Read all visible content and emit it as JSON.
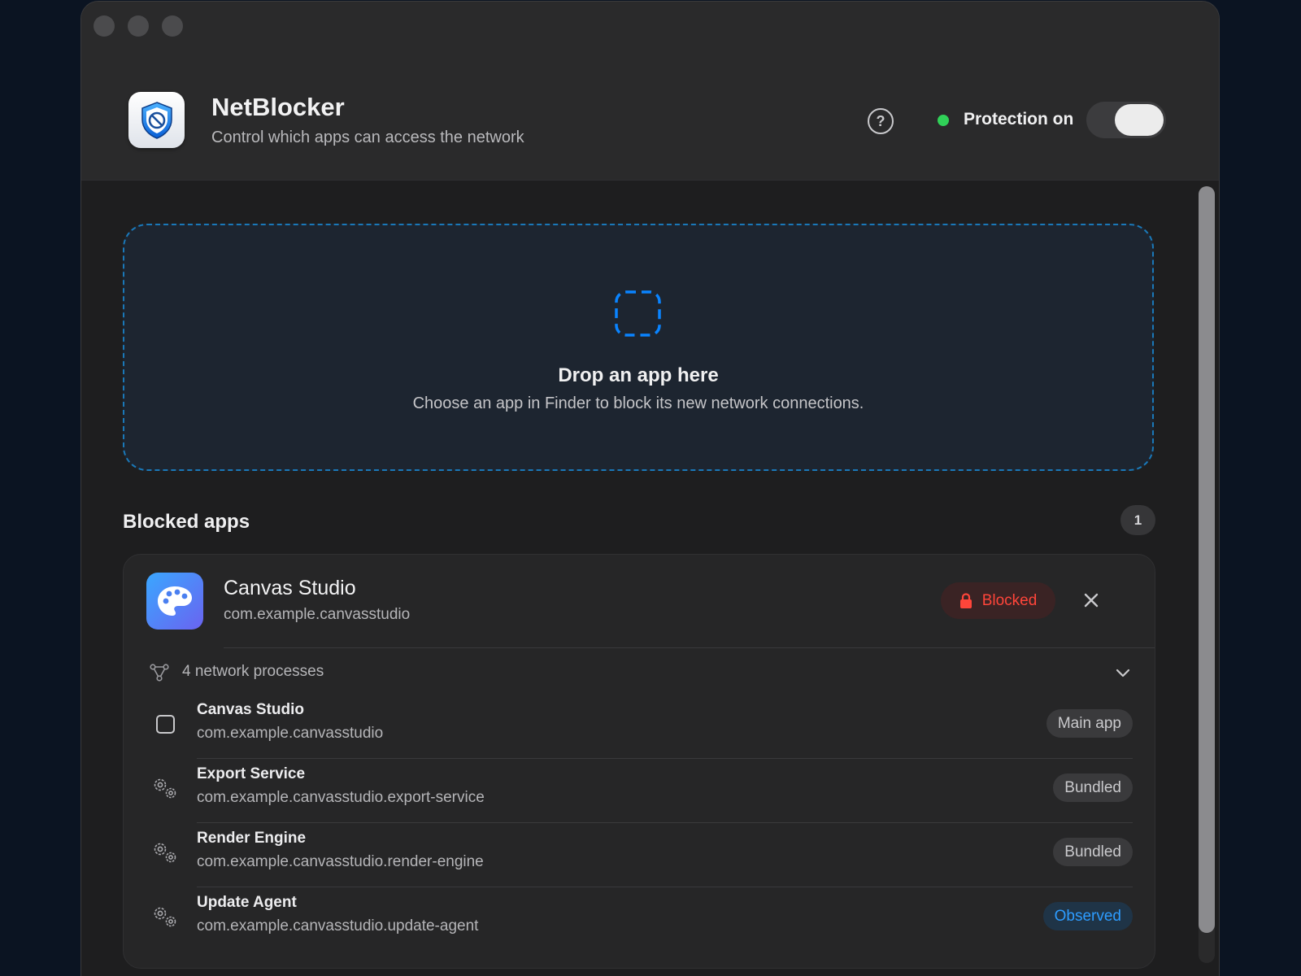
{
  "header": {
    "app_title": "NetBlocker",
    "app_subtitle": "Control which apps can access the network",
    "help_icon": "question-mark-icon",
    "protection_label": "Protection on",
    "protection_status_color": "#30d158",
    "protection_enabled": true
  },
  "dropzone": {
    "icon": "dashed-square-icon",
    "title": "Drop an app here",
    "description": "Choose an app in Finder to block its new network connections."
  },
  "blocked": {
    "section_title": "Blocked apps",
    "count": "1",
    "apps": [
      {
        "name": "Canvas Studio",
        "bundle_id": "com.example.canvasstudio",
        "icon": "palette-icon",
        "status_label": "Blocked",
        "status_color": "#ff453a",
        "processes_label": "4 network processes",
        "processes": [
          {
            "name": "Canvas Studio",
            "bundle_id": "com.example.canvasstudio",
            "tag": "Main app",
            "icon": "app-window-icon"
          },
          {
            "name": "Export Service",
            "bundle_id": "com.example.canvasstudio.export-service",
            "tag": "Bundled",
            "icon": "gears-icon"
          },
          {
            "name": "Render Engine",
            "bundle_id": "com.example.canvasstudio.render-engine",
            "tag": "Bundled",
            "icon": "gears-icon"
          },
          {
            "name": "Update Agent",
            "bundle_id": "com.example.canvasstudio.update-agent",
            "tag": "Observed",
            "icon": "gears-icon"
          }
        ]
      }
    ]
  },
  "colors": {
    "accent": "#1a78b8",
    "observed": "#2d9cff",
    "window_bg": "#1e1e1f"
  }
}
